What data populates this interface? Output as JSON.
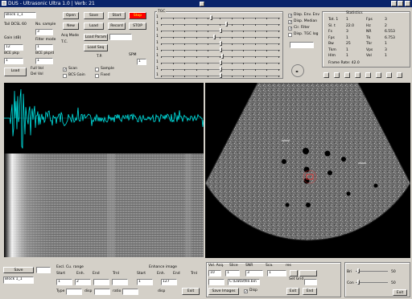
{
  "window": {
    "title": "DUS - Ultrasonic Ultra 1.0 | Verb: 21"
  },
  "top_left": {
    "file_field": "Block 1_1",
    "btn_open": "Open",
    "btn_save": "Save",
    "btn_start": "Start",
    "btn_stop": "Stop",
    "btn_new": "New",
    "btn_load": "Load",
    "btn_record": "Record",
    "btn_stop2": "STOP",
    "lbl_depth_left": "Tail DCSL 60",
    "lbl_sample": "No. sample",
    "sample_val": "3",
    "lbl_gain": "Gain (dB)",
    "lbl_filter": "Filter mode",
    "gain_val": "12",
    "filter_val": "1",
    "lbl_frames": "BCE pkp",
    "lbl_vols": "BCE pkp/d",
    "frames_val": "1",
    "vols_val": "1",
    "btn_lr": "Load",
    "lbl_fv": "Full Vol",
    "lbl_dv": "Del Vol",
    "btn_loadpar": "Load Param",
    "btn_loadseq": "Load Seq",
    "lbl_acq": "Acq Mode",
    "lbl_tc": "T.C.",
    "cb_scan": "Scan",
    "cb_bcs": "BCS Gain",
    "cb_sample": "Sample",
    "cb_fixed": "Fixed",
    "lbl_tp": "T.P.",
    "tp_val": "1",
    "lbl_spm": "SPM"
  },
  "tgc": {
    "label": "TGC",
    "levels": [
      0.42,
      0.55,
      0.5,
      0.45,
      0.5,
      0.5,
      0.52,
      0.5,
      0.5,
      0.5
    ],
    "ticks_label": "1"
  },
  "checks": [
    {
      "label": "Disp. Env. Env",
      "checked": true
    },
    {
      "label": "Disp. Median",
      "checked": true
    },
    {
      "label": "Cir. Filter",
      "checked": true
    },
    {
      "label": "Disp. TGC log",
      "checked": false
    }
  ],
  "stats": {
    "title": "Statistics",
    "rows": [
      [
        "Tot. 1",
        "1",
        "Fps",
        "3"
      ],
      [
        "Sl. t",
        "22.0",
        "Hz",
        "2"
      ],
      [
        "Fs",
        "3",
        "NR",
        "6.553"
      ],
      [
        "Fps",
        "1",
        "Tk",
        "6.753"
      ],
      [
        "Bw",
        "25",
        "Tkr",
        "1"
      ],
      [
        "Tkm",
        "1",
        "Vps",
        "3"
      ],
      [
        "Hlm",
        "1",
        "Vol",
        "1"
      ]
    ],
    "footer": "Frame Rate: 42.0"
  },
  "bottom": {
    "btn_save": "Save",
    "file_val": "Block 1_1",
    "lbl_excl": "Excl. Cu. range",
    "lbl_cur_range": "Start",
    "lbl_enh": "Enh.",
    "lbl_en": "End",
    "lbl_trnl": "Trnl",
    "start_val": "1",
    "end_val": "2",
    "lbl_enhance": "Enhance image",
    "lbl_start2": "Start",
    "lbl_enh2": "Enh.",
    "lbl_end2": "End",
    "lbl_trnl2": "Trnl",
    "e_start": "1",
    "e_end": "127",
    "lbl_type": "Type",
    "lbl_disp": "disp",
    "lbl_ratio": "ratio",
    "btn_exit": "Exit",
    "lbl_vol": "Vol. Acq.",
    "lbl_slice": "Slice",
    "lbl_snr": "SNR",
    "lbl_sca": "Sca.",
    "lbl_res": "res",
    "vol_val": "10",
    "slice_val": "1",
    "snr_val": "3",
    "sca_val": "1",
    "lbl_setgrid": "Set Grid",
    "fname": "C:\\Data\\file.bin",
    "btn_save_images": "Save Images",
    "cb_disp": "Disp",
    "btn_exit2": "Exit",
    "btn_end": "End",
    "lbl_bri": "Bri",
    "lbl_con": "Con",
    "bri_val": "50",
    "con_val": "50",
    "btn_exit3": "Exit"
  },
  "colors": {
    "trace": "#00e5e5",
    "background": "#d4d0c8",
    "title": "#0a246a",
    "roi": "#ff3030"
  }
}
